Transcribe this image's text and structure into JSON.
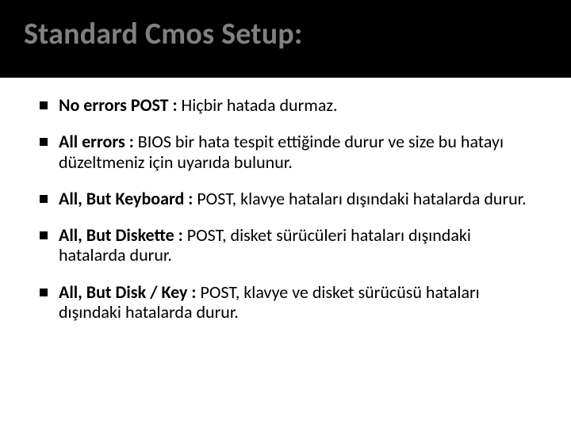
{
  "slide": {
    "title": "Standard Cmos Setup:",
    "bullets": [
      {
        "lead": "No errors POST :",
        "rest": " Hiçbir hatada durmaz."
      },
      {
        "lead": "All errors :",
        "rest": " BIOS bir hata tespit ettiğinde durur ve size bu hatayı düzeltmeniz için uyarıda bulunur."
      },
      {
        "lead": "All, But Keyboard :",
        "rest": " POST, klavye hataları dışındaki hatalarda durur."
      },
      {
        "lead": "All, But Diskette :",
        "rest": " POST, disket sürücüleri hataları dışındaki hatalarda durur."
      },
      {
        "lead": "All, But Disk / Key :",
        "rest": " POST, klavye ve disket sürücüsü hataları dışındaki hatalarda durur."
      }
    ]
  }
}
